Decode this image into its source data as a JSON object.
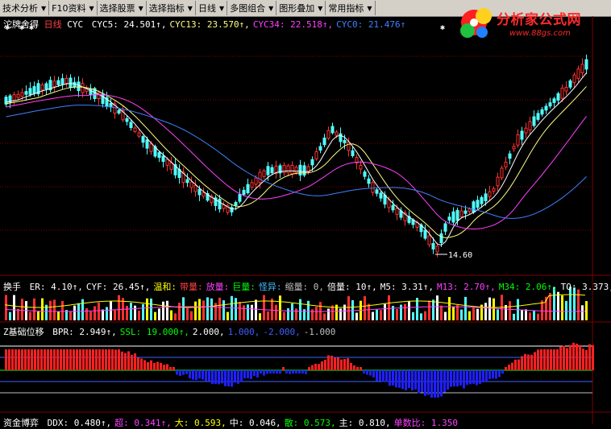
{
  "toolbar": {
    "items": [
      {
        "label": "技术分析"
      },
      {
        "label": "F10资料"
      },
      {
        "label": "选择股票"
      },
      {
        "label": "选择指标"
      },
      {
        "label": "日线"
      },
      {
        "label": "多图组合"
      },
      {
        "label": "图形叠加"
      },
      {
        "label": "常用指标"
      }
    ]
  },
  "logo": {
    "brand": "分析家公式网",
    "url": "www.88gs.com"
  },
  "panel1": {
    "name": "沱牌舍得",
    "period": "日线",
    "indicator": "CYC",
    "items": [
      {
        "text": "CYC5: 24.501↑,",
        "color": "#ffffff"
      },
      {
        "text": "CYC13: 23.570↑,",
        "color": "#ffff80"
      },
      {
        "text": "CYC34: 22.518↑,",
        "color": "#ff40ff"
      },
      {
        "text": "CYC0: 21.476↑",
        "color": "#4080ff"
      }
    ],
    "low_label": "14.60"
  },
  "panel2": {
    "name": "换手",
    "items": [
      {
        "text": "ER: 4.10↑,",
        "color": "#ffffff"
      },
      {
        "text": "CYF: 26.45↑,",
        "color": "#ffffff"
      },
      {
        "text": "温和:",
        "color": "#ffff00"
      },
      {
        "text": "带量:",
        "color": "#ff4040"
      },
      {
        "text": "放量:",
        "color": "#ff40ff"
      },
      {
        "text": "巨量:",
        "color": "#00ff00"
      },
      {
        "text": "怪异:",
        "color": "#40c0ff"
      },
      {
        "text": "缩量: 0,",
        "color": "#c0c0c0"
      },
      {
        "text": "倍量: 10↑,",
        "color": "#ffffff"
      },
      {
        "text": "M5: 3.31↑,",
        "color": "#ffffff"
      },
      {
        "text": "M13: 2.70↑,",
        "color": "#ff40ff"
      },
      {
        "text": "M34: 2.06↑,",
        "color": "#00ff00"
      },
      {
        "text": "TQ: 3.373,",
        "color": "#ffffff"
      }
    ]
  },
  "panel3": {
    "name": "Z基础位移",
    "items": [
      {
        "text": "BPR: 2.949↑,",
        "color": "#ffffff"
      },
      {
        "text": "SSL: 19.000↑,",
        "color": "#00ff00"
      },
      {
        "text": "2.000,",
        "color": "#ffffff"
      },
      {
        "text": "1.000,",
        "color": "#4060ff"
      },
      {
        "text": "-2.000,",
        "color": "#4060ff"
      },
      {
        "text": "-1.000",
        "color": "#c0c0c0"
      }
    ]
  },
  "panel4": {
    "name": "资金博弈",
    "items": [
      {
        "text": "DDX: 0.480↑,",
        "color": "#ffffff"
      },
      {
        "text": "超: 0.341↑,",
        "color": "#ff40ff"
      },
      {
        "text": "大: 0.593,",
        "color": "#ffff00"
      },
      {
        "text": "中: 0.046,",
        "color": "#ffffff"
      },
      {
        "text": "散: 0.573,",
        "color": "#00ff00"
      },
      {
        "text": "主: 0.810,",
        "color": "#ffffff"
      },
      {
        "text": "单数比: 1.350",
        "color": "#ff40ff"
      }
    ]
  },
  "colors": {
    "up": "#ff3030",
    "down": "#50ffff",
    "bg": "#000000",
    "grid": "#800000"
  }
}
